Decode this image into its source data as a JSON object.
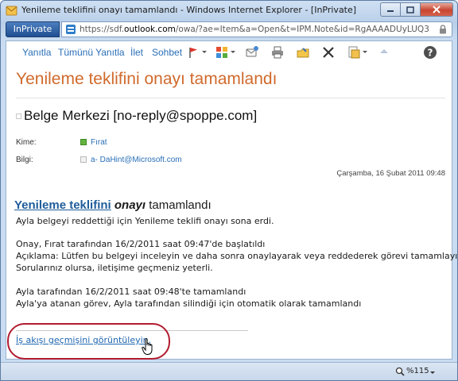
{
  "window": {
    "title": "Yenileme teklifini onayı tamamlandı - Windows Internet Explorer - [InPrivate]"
  },
  "address_bar": {
    "inprivate_label": "InPrivate",
    "url_prefix": "https://sdf.",
    "url_domain": "outlook.com",
    "url_rest": "/owa/?ae=Item&a=Open&t=IPM.Note&id=RgAAAADUyLUQ3%2byTJBdVM"
  },
  "toolbar": {
    "reply": "Yanıtla",
    "reply_all": "Tümünü Yanıtla",
    "forward": "İlet",
    "chat": "Sohbet"
  },
  "message": {
    "subject": "Yenileme teklifini onayı tamamlandı",
    "sender": "Belge Merkezi [no-reply@spoppe.com]",
    "to_label": "Kime:",
    "to_value": "Fırat",
    "cc_label": "Bilgi:",
    "cc_value": "a- DaHint@Microsoft.com",
    "date": "Çarşamba, 16 Şubat 2011 09:48"
  },
  "body": {
    "heading_link": "Yenileme teklifini",
    "heading_em": "onayı",
    "heading_rest": " tamamlandı",
    "line1": "Ayla belgeyi reddettiği için Yenileme teklifi onayı sona erdi.",
    "line2": "Onay, Fırat tarafından 16/2/2011 saat 09:47'de başlatıldı",
    "line3": "Açıklama: Lütfen bu belgeyi inceleyin ve daha sonra onaylayarak veya reddederek görevi tamamlayın.",
    "line4": "Sorularınız olursa, iletişime geçmeniz yeterli.",
    "line5": "Ayla tarafından 16/2/2011 saat 09:48'te tamamlandı",
    "line6": "Ayla'ya atanan görev, Ayla tarafından silindiği için otomatik olarak tamamlandı",
    "history_link": "İş akışı geçmişini görüntüleyin."
  },
  "status_bar": {
    "zoom": "%115"
  },
  "colors": {
    "subject": "#d06a2c",
    "link": "#2a6fb7",
    "highlight": "#b11b2f",
    "inprivate_bg": "#1f4f91"
  }
}
